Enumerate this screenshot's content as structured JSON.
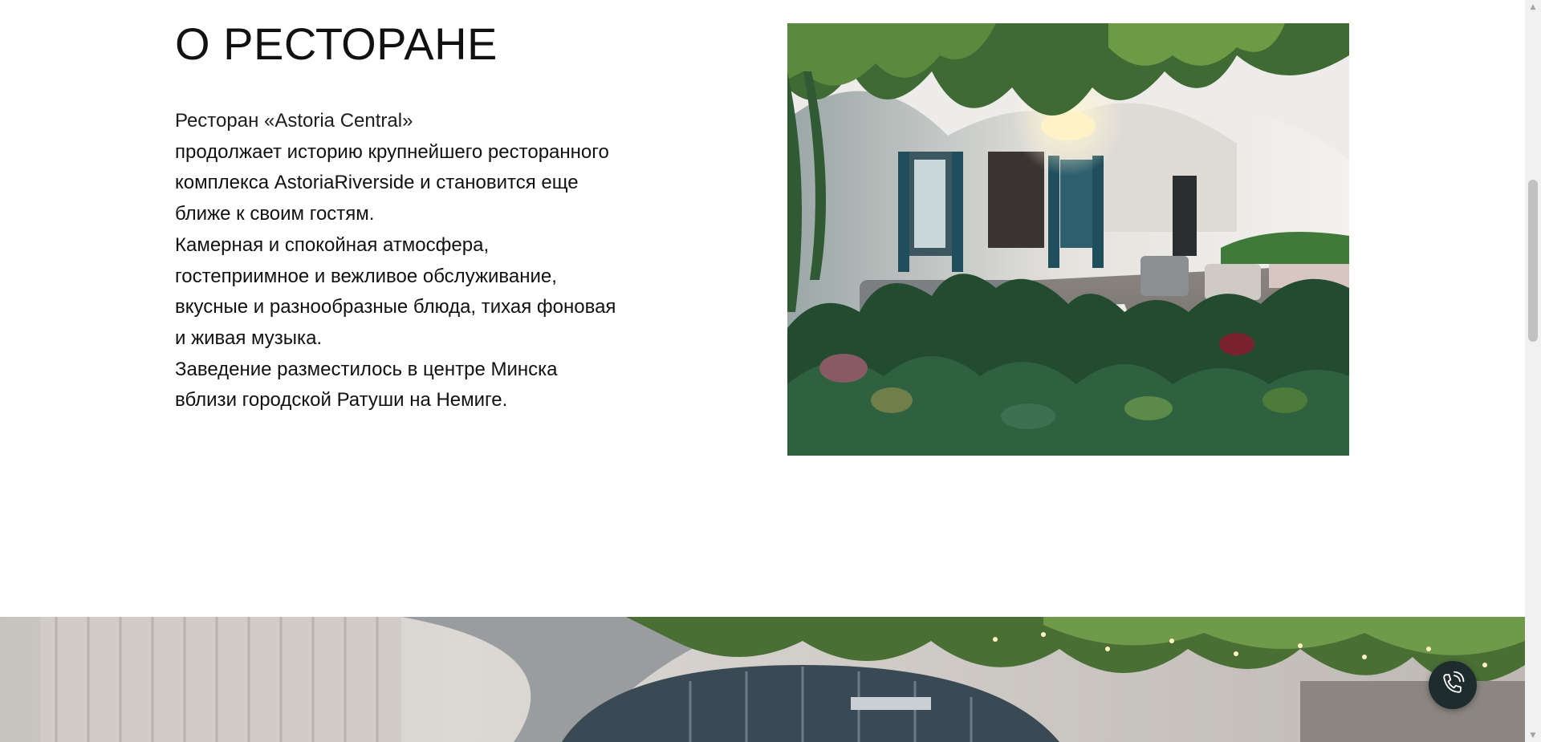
{
  "about": {
    "title": "О РЕСТОРАНЕ",
    "text_lines": [
      "Ресторан «Astoria Central»",
      "продолжает историю крупнейшего ресторанного",
      "комплекса AstoriaRiverside и становится еще",
      "ближе к своим гостям.",
      "Камерная и спокойная атмосфера,",
      "гостеприимное и вежливое обслуживание,",
      "вкусные и разнообразные блюда, тихая фоновая",
      "и живая музыка.",
      "Заведение разместилось в центре Минска",
      "вблизи городской Ратуши на Немиге."
    ],
    "photo": "restaurant-interior-photo"
  },
  "banner": {
    "photo": "restaurant-hall-banner-photo"
  },
  "call_button": {
    "icon": "phone-icon",
    "color": "#1f2c2e"
  },
  "scrollbar": {
    "up_arrow": "▲",
    "down_arrow": "▼"
  }
}
